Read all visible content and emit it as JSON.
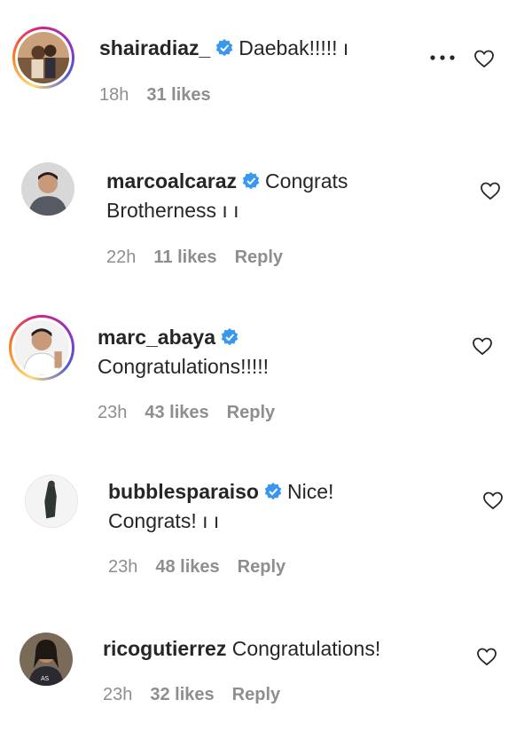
{
  "comments": [
    {
      "username": "shairadiaz_",
      "verified": true,
      "text_line1": "Daebak!!!!! ı",
      "text_line2": "",
      "time": "18h",
      "likes": "31 likes",
      "reply": "",
      "story_ring": true
    },
    {
      "username": "marcoalcaraz",
      "verified": true,
      "text_line1": "Congrats",
      "text_line2": "Brotherness ı ı",
      "time": "22h",
      "likes": "11 likes",
      "reply": "Reply",
      "story_ring": false
    },
    {
      "username": "marc_abaya",
      "verified": true,
      "text_line1": "",
      "text_line2": "Congratulations!!!!!",
      "time": "23h",
      "likes": "43 likes",
      "reply": "Reply",
      "story_ring": true
    },
    {
      "username": "bubblesparaiso",
      "verified": true,
      "text_line1": "Nice!",
      "text_line2": "Congrats! ı ı",
      "time": "23h",
      "likes": "48 likes",
      "reply": "Reply",
      "story_ring": false
    },
    {
      "username": "ricogutierrez",
      "verified": false,
      "text_line1": "Congratulations!",
      "text_line2": "",
      "time": "23h",
      "likes": "32 likes",
      "reply": "Reply",
      "story_ring": false
    }
  ],
  "colors": {
    "verified_badge": "#3897f0",
    "meta_text": "#8e8e8e",
    "primary_text": "#262626"
  },
  "icons": {
    "like": "heart-outline-icon",
    "more": "more-options-icon",
    "verified": "verified-badge-icon"
  }
}
